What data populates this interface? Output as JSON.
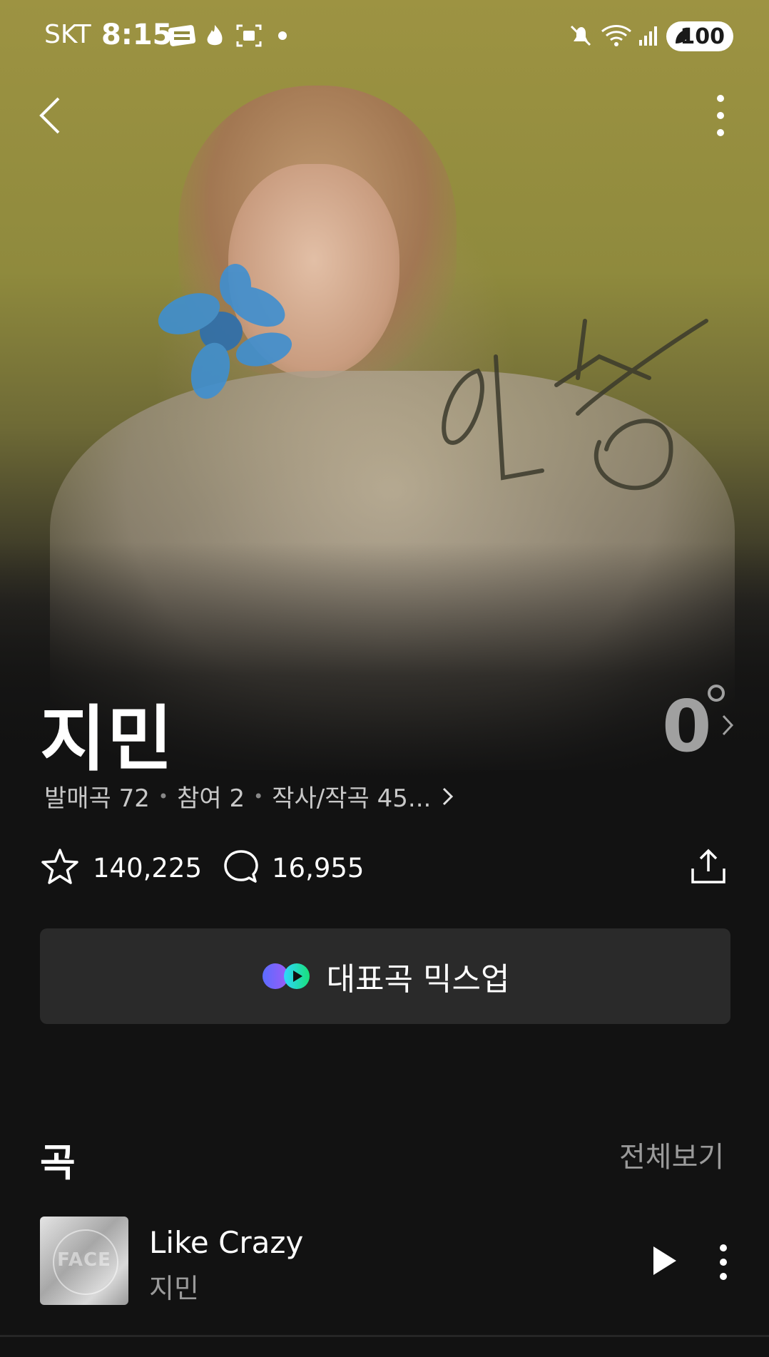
{
  "status_bar": {
    "carrier": "SKT",
    "time": "8:15",
    "battery": "100",
    "icons": [
      "webtoon-icon",
      "flame-icon",
      "screenshot-icon",
      "dot-icon",
      "mute-icon",
      "wifi-icon",
      "signal-icon",
      "battery-icon"
    ]
  },
  "header": {
    "back_icon": "back-chevron-icon",
    "more_icon": "more-vertical-icon"
  },
  "artist": {
    "name": "지민",
    "temperature": "0",
    "stats": {
      "released": "발매곡 72",
      "participated": "참여 2",
      "written": "작사/작곡 45..."
    }
  },
  "actions": {
    "likes": "140,225",
    "comments": "16,955",
    "share_icon": "share-icon"
  },
  "mixup": {
    "label": "대표곡 믹스업"
  },
  "songs_section": {
    "title": "곡",
    "view_all": "전체보기",
    "items": [
      {
        "title": "Like Crazy",
        "artist": "지민",
        "album_text": "FACE"
      }
    ]
  },
  "colors": {
    "background": "#121212",
    "button_bg": "#2a2a2a",
    "hero_olive": "#9d9342",
    "muted_text": "#9a9a9a"
  }
}
